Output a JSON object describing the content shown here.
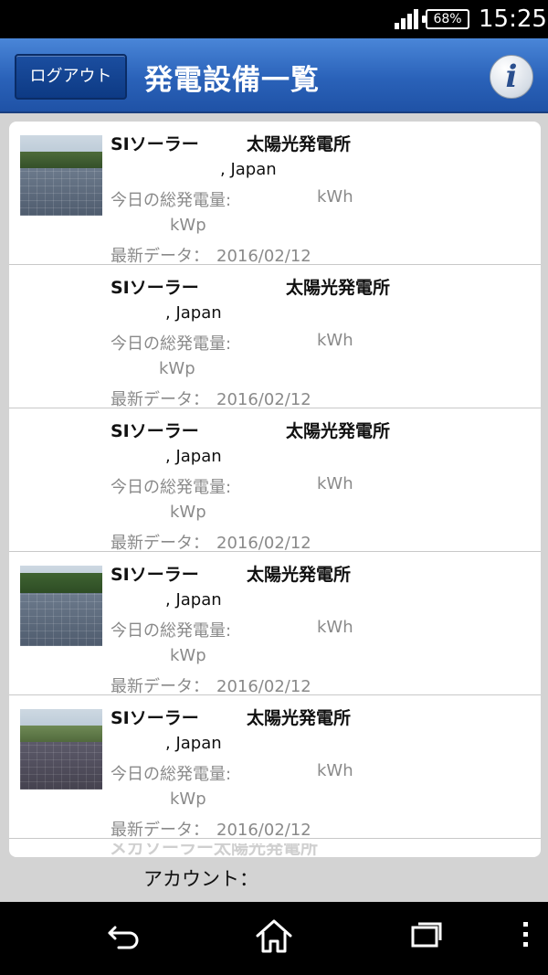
{
  "status_bar": {
    "battery_percent": "68%",
    "time": "15:25",
    "icons": [
      "signal-icon",
      "battery-icon"
    ]
  },
  "header": {
    "logout_label": "ログアウト",
    "title": "発電設備一覧",
    "info_glyph": "i"
  },
  "list": {
    "items": [
      {
        "name_a": "SIソーラー",
        "name_b": "太陽光発電所",
        "location": ", Japan",
        "generation_label": "今日の総発電量:",
        "generation_unit": "kWh",
        "capacity_unit": "kWp",
        "latest_label": "最新データ：",
        "latest_date": "2016/02/12",
        "has_thumbnail": true
      },
      {
        "name_a": "SIソーラー",
        "name_b": "太陽光発電所",
        "location": ", Japan",
        "generation_label": "今日の総発電量:",
        "generation_unit": "kWh",
        "capacity_unit": "kWp",
        "latest_label": "最新データ：",
        "latest_date": "2016/02/12",
        "has_thumbnail": false
      },
      {
        "name_a": "SIソーラー",
        "name_b": "太陽光発電所",
        "location": ", Japan",
        "generation_label": "今日の総発電量:",
        "generation_unit": "kWh",
        "capacity_unit": "kWp",
        "latest_label": "最新データ：",
        "latest_date": "2016/02/12",
        "has_thumbnail": false
      },
      {
        "name_a": "SIソーラー",
        "name_b": "太陽光発電所",
        "location": ", Japan",
        "generation_label": "今日の総発電量:",
        "generation_unit": "kWh",
        "capacity_unit": "kWp",
        "latest_label": "最新データ：",
        "latest_date": "2016/02/12",
        "has_thumbnail": true
      },
      {
        "name_a": "SIソーラー",
        "name_b": "太陽光発電所",
        "location": ", Japan",
        "generation_label": "今日の総発電量:",
        "generation_unit": "kWh",
        "capacity_unit": "kWp",
        "latest_label": "最新データ：",
        "latest_date": "2016/02/12",
        "has_thumbnail": true
      }
    ],
    "partial_item_text": "メガソーラー太陽光発電所"
  },
  "footer": {
    "account_label": "アカウント："
  },
  "nav_bar": {
    "icons": [
      "back-icon",
      "home-icon",
      "recent-apps-icon",
      "menu-icon"
    ]
  }
}
